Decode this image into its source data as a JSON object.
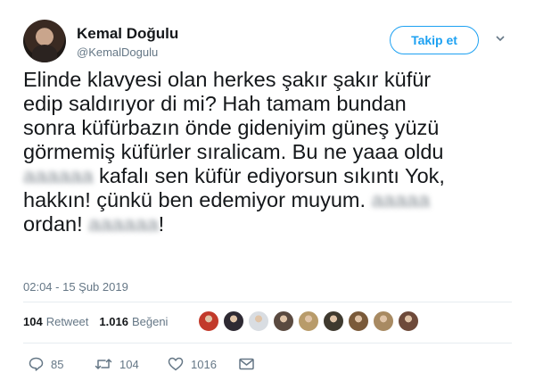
{
  "user": {
    "display_name": "Kemal Doğulu",
    "handle": "@KemalDogulu"
  },
  "follow_button": {
    "label": "Takip et"
  },
  "tweet": {
    "lines": [
      "Elinde klavyesi olan herkes şakır şakır küfür",
      "edip saldırıyor di mi? Hah tamam bundan",
      "sonra küfürbazın önde gideniyim güneş yüzü",
      "görmemiş küfürler sıralicam. Bu ne yaaa oldu"
    ],
    "line5_rest": "kafalı sen küfür ediyorsun sıkıntı Yok,",
    "line6": "hakkın! çünkü ben edemiyor muyum.",
    "line7_start": "ordan!",
    "line7_end": "!",
    "timestamp": "02:04 - 15 Şub 2019"
  },
  "stats": {
    "retweets_count": "104",
    "retweets_label": "Retweet",
    "likes_count": "1.016",
    "likes_label": "Beğeni"
  },
  "likers": {
    "colors": [
      "#c23a2b",
      "#2e2a33",
      "#d9dde2",
      "#5a4a40",
      "#b89b6a",
      "#3f3a2f",
      "#7a5a3a",
      "#a88a62",
      "#6e4a3a"
    ]
  },
  "actions": {
    "replies": "85",
    "retweets": "104",
    "likes": "1016"
  },
  "colors": {
    "accent": "#1da1f2",
    "text": "#14171a",
    "muted": "#657786"
  }
}
